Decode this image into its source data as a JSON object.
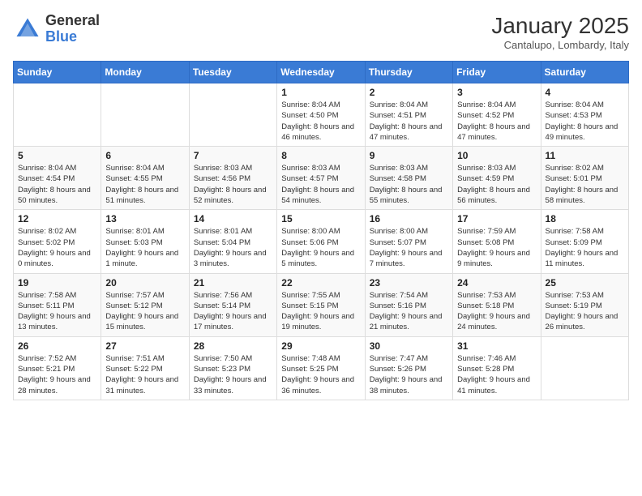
{
  "logo": {
    "general": "General",
    "blue": "Blue"
  },
  "header": {
    "month": "January 2025",
    "location": "Cantalupo, Lombardy, Italy"
  },
  "days_of_week": [
    "Sunday",
    "Monday",
    "Tuesday",
    "Wednesday",
    "Thursday",
    "Friday",
    "Saturday"
  ],
  "weeks": [
    [
      {
        "day": null
      },
      {
        "day": null
      },
      {
        "day": null
      },
      {
        "day": "1",
        "sunrise": "8:04 AM",
        "sunset": "4:50 PM",
        "daylight": "8 hours and 46 minutes."
      },
      {
        "day": "2",
        "sunrise": "8:04 AM",
        "sunset": "4:51 PM",
        "daylight": "8 hours and 47 minutes."
      },
      {
        "day": "3",
        "sunrise": "8:04 AM",
        "sunset": "4:52 PM",
        "daylight": "8 hours and 47 minutes."
      },
      {
        "day": "4",
        "sunrise": "8:04 AM",
        "sunset": "4:53 PM",
        "daylight": "8 hours and 49 minutes."
      }
    ],
    [
      {
        "day": "5",
        "sunrise": "8:04 AM",
        "sunset": "4:54 PM",
        "daylight": "8 hours and 50 minutes."
      },
      {
        "day": "6",
        "sunrise": "8:04 AM",
        "sunset": "4:55 PM",
        "daylight": "8 hours and 51 minutes."
      },
      {
        "day": "7",
        "sunrise": "8:03 AM",
        "sunset": "4:56 PM",
        "daylight": "8 hours and 52 minutes."
      },
      {
        "day": "8",
        "sunrise": "8:03 AM",
        "sunset": "4:57 PM",
        "daylight": "8 hours and 54 minutes."
      },
      {
        "day": "9",
        "sunrise": "8:03 AM",
        "sunset": "4:58 PM",
        "daylight": "8 hours and 55 minutes."
      },
      {
        "day": "10",
        "sunrise": "8:03 AM",
        "sunset": "4:59 PM",
        "daylight": "8 hours and 56 minutes."
      },
      {
        "day": "11",
        "sunrise": "8:02 AM",
        "sunset": "5:01 PM",
        "daylight": "8 hours and 58 minutes."
      }
    ],
    [
      {
        "day": "12",
        "sunrise": "8:02 AM",
        "sunset": "5:02 PM",
        "daylight": "9 hours and 0 minutes."
      },
      {
        "day": "13",
        "sunrise": "8:01 AM",
        "sunset": "5:03 PM",
        "daylight": "9 hours and 1 minute."
      },
      {
        "day": "14",
        "sunrise": "8:01 AM",
        "sunset": "5:04 PM",
        "daylight": "9 hours and 3 minutes."
      },
      {
        "day": "15",
        "sunrise": "8:00 AM",
        "sunset": "5:06 PM",
        "daylight": "9 hours and 5 minutes."
      },
      {
        "day": "16",
        "sunrise": "8:00 AM",
        "sunset": "5:07 PM",
        "daylight": "9 hours and 7 minutes."
      },
      {
        "day": "17",
        "sunrise": "7:59 AM",
        "sunset": "5:08 PM",
        "daylight": "9 hours and 9 minutes."
      },
      {
        "day": "18",
        "sunrise": "7:58 AM",
        "sunset": "5:09 PM",
        "daylight": "9 hours and 11 minutes."
      }
    ],
    [
      {
        "day": "19",
        "sunrise": "7:58 AM",
        "sunset": "5:11 PM",
        "daylight": "9 hours and 13 minutes."
      },
      {
        "day": "20",
        "sunrise": "7:57 AM",
        "sunset": "5:12 PM",
        "daylight": "9 hours and 15 minutes."
      },
      {
        "day": "21",
        "sunrise": "7:56 AM",
        "sunset": "5:14 PM",
        "daylight": "9 hours and 17 minutes."
      },
      {
        "day": "22",
        "sunrise": "7:55 AM",
        "sunset": "5:15 PM",
        "daylight": "9 hours and 19 minutes."
      },
      {
        "day": "23",
        "sunrise": "7:54 AM",
        "sunset": "5:16 PM",
        "daylight": "9 hours and 21 minutes."
      },
      {
        "day": "24",
        "sunrise": "7:53 AM",
        "sunset": "5:18 PM",
        "daylight": "9 hours and 24 minutes."
      },
      {
        "day": "25",
        "sunrise": "7:53 AM",
        "sunset": "5:19 PM",
        "daylight": "9 hours and 26 minutes."
      }
    ],
    [
      {
        "day": "26",
        "sunrise": "7:52 AM",
        "sunset": "5:21 PM",
        "daylight": "9 hours and 28 minutes."
      },
      {
        "day": "27",
        "sunrise": "7:51 AM",
        "sunset": "5:22 PM",
        "daylight": "9 hours and 31 minutes."
      },
      {
        "day": "28",
        "sunrise": "7:50 AM",
        "sunset": "5:23 PM",
        "daylight": "9 hours and 33 minutes."
      },
      {
        "day": "29",
        "sunrise": "7:48 AM",
        "sunset": "5:25 PM",
        "daylight": "9 hours and 36 minutes."
      },
      {
        "day": "30",
        "sunrise": "7:47 AM",
        "sunset": "5:26 PM",
        "daylight": "9 hours and 38 minutes."
      },
      {
        "day": "31",
        "sunrise": "7:46 AM",
        "sunset": "5:28 PM",
        "daylight": "9 hours and 41 minutes."
      },
      {
        "day": null
      }
    ]
  ]
}
